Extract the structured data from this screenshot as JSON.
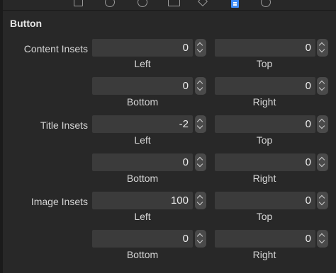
{
  "tabs": [
    {
      "icon": "file-icon"
    },
    {
      "icon": "help-icon"
    },
    {
      "icon": "identity-icon"
    },
    {
      "icon": "attributes-icon"
    },
    {
      "icon": "size-icon"
    },
    {
      "icon": "connections-icon",
      "selected": true
    },
    {
      "icon": "effects-icon"
    }
  ],
  "section": {
    "title": "Button"
  },
  "groups": [
    {
      "label": "Content Insets",
      "fields": {
        "left": {
          "value": "0",
          "label": "Left"
        },
        "top": {
          "value": "0",
          "label": "Top"
        },
        "bottom": {
          "value": "0",
          "label": "Bottom"
        },
        "right": {
          "value": "0",
          "label": "Right"
        }
      }
    },
    {
      "label": "Title Insets",
      "fields": {
        "left": {
          "value": "-2",
          "label": "Left"
        },
        "top": {
          "value": "0",
          "label": "Top"
        },
        "bottom": {
          "value": "0",
          "label": "Bottom"
        },
        "right": {
          "value": "0",
          "label": "Right"
        }
      }
    },
    {
      "label": "Image Insets",
      "fields": {
        "left": {
          "value": "100",
          "label": "Left"
        },
        "top": {
          "value": "0",
          "label": "Top"
        },
        "bottom": {
          "value": "0",
          "label": "Bottom"
        },
        "right": {
          "value": "0",
          "label": "Right"
        }
      }
    }
  ],
  "colors": {
    "background": "#282828",
    "field": "#3b3b3b",
    "accent": "#3d8bf7"
  }
}
